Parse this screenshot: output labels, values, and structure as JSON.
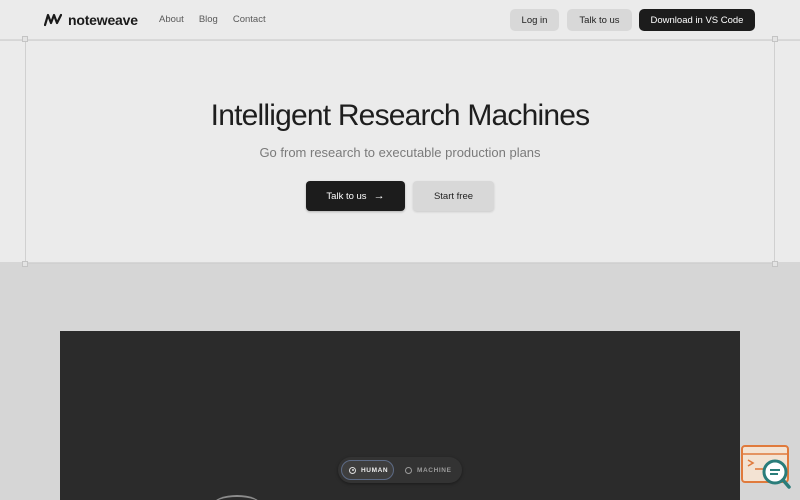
{
  "header": {
    "brand": "noteweave",
    "nav": [
      "About",
      "Blog",
      "Contact"
    ],
    "login_label": "Log in",
    "talk_label": "Talk to us",
    "download_label": "Download in VS Code"
  },
  "hero": {
    "title": "Intelligent Research Machines",
    "subtitle": "Go from research to executable production plans",
    "primary_label": "Talk to us",
    "secondary_label": "Start free"
  },
  "demo": {
    "toggle": {
      "human_label": "HUMAN",
      "machine_label": "MACHINE",
      "selected": "HUMAN"
    }
  },
  "icons": {
    "logo": "noteweave-logo-icon",
    "arrow": "arrow-right-icon",
    "widget": "search-chat-widget-icon"
  },
  "colors": {
    "page_bg": "#d6d6d6",
    "hero_bg": "#ebebeb",
    "primary_button": "#1c1c1c",
    "secondary_button": "#d8d8d8",
    "demo_bg": "#2b2b2b",
    "widget_accent": "#e07a3c",
    "widget_teal": "#2a7d7a"
  }
}
